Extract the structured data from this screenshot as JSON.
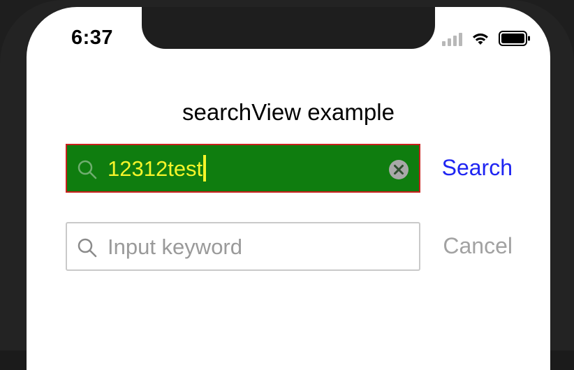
{
  "status_bar": {
    "time": "6:37",
    "signal_icon": "cellular-signal-icon",
    "wifi_icon": "wifi-icon",
    "battery_icon": "battery-icon"
  },
  "page": {
    "title": "searchView example"
  },
  "search_views": [
    {
      "value": "12312test",
      "placeholder": "Input keyword",
      "focused": true,
      "action_label": "Search",
      "colors": {
        "background": "#0f7d0f",
        "border": "#c8201c",
        "text": "#f5f52a",
        "action": "#1f25f2"
      }
    },
    {
      "value": "",
      "placeholder": "Input keyword",
      "focused": false,
      "action_label": "Cancel",
      "colors": {
        "background": "#ffffff",
        "border": "#c9c9c9",
        "text": "#9a9a9a",
        "action": "#a2a2a2"
      }
    }
  ]
}
